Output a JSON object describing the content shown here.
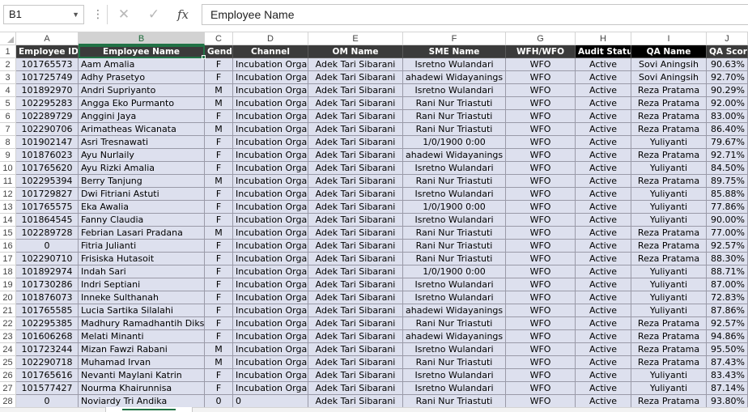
{
  "formula_bar": {
    "name_box": "B1",
    "name_box_dropdown_icon": "chevron-down-icon",
    "more_icon": "vertical-ellipsis-icon",
    "cancel_icon": "close-icon",
    "enter_icon": "checkmark-icon",
    "fx_label": "fx",
    "formula": "Employee Name"
  },
  "column_letters": [
    "A",
    "B",
    "C",
    "D",
    "E",
    "F",
    "G",
    "H",
    "I",
    "J"
  ],
  "selected_column": "B",
  "colors": {
    "header_bg": "#3b3b3b",
    "header_black_bg": "#000000",
    "data_bg": "#dde0ee",
    "selection": "#217346"
  },
  "headers": [
    "Employee ID",
    "Employee Name",
    "Gender",
    "Channel",
    "OM Name",
    "SME Name",
    "WFH/WFO",
    "Audit Status",
    "QA Name",
    "QA Score"
  ],
  "rows": [
    {
      "n": "2",
      "cells": [
        "101765573",
        "Aam Amalia",
        "F",
        "Incubation Organic",
        "Adek Tari Sibarani",
        "Isretno Wulandari",
        "WFO",
        "Active",
        "Sovi Aningsih",
        "90.63%"
      ]
    },
    {
      "n": "3",
      "cells": [
        "101725749",
        "Adhy Prasetyo",
        "F",
        "Incubation Organic",
        "Adek Tari Sibarani",
        "ahadewi Widayanings",
        "WFO",
        "Active",
        "Sovi Aningsih",
        "92.70%"
      ]
    },
    {
      "n": "4",
      "cells": [
        "101892970",
        "Andri Supriyanto",
        "M",
        "Incubation Organic",
        "Adek Tari Sibarani",
        "Isretno Wulandari",
        "WFO",
        "Active",
        "Reza Pratama",
        "90.29%"
      ]
    },
    {
      "n": "5",
      "cells": [
        "102295283",
        "Angga Eko Purmanto",
        "M",
        "Incubation Organic",
        "Adek Tari Sibarani",
        "Rani Nur Triastuti",
        "WFO",
        "Active",
        "Reza Pratama",
        "92.00%"
      ]
    },
    {
      "n": "6",
      "cells": [
        "102289729",
        "Anggini Jaya",
        "F",
        "Incubation Organic",
        "Adek Tari Sibarani",
        "Rani Nur Triastuti",
        "WFO",
        "Active",
        "Reza Pratama",
        "83.00%"
      ]
    },
    {
      "n": "7",
      "cells": [
        "102290706",
        "Arimatheas Wicanata",
        "M",
        "Incubation Organic",
        "Adek Tari Sibarani",
        "Rani Nur Triastuti",
        "WFO",
        "Active",
        "Reza Pratama",
        "86.40%"
      ]
    },
    {
      "n": "8",
      "cells": [
        "101902147",
        "Asri Tresnawati",
        "F",
        "Incubation Organic",
        "Adek Tari Sibarani",
        "1/0/1900 0:00",
        "WFO",
        "Active",
        "Yuliyanti",
        "79.67%"
      ]
    },
    {
      "n": "9",
      "cells": [
        "101876023",
        "Ayu Nurlaily",
        "F",
        "Incubation Organic",
        "Adek Tari Sibarani",
        "ahadewi Widayanings",
        "WFO",
        "Active",
        "Reza Pratama",
        "92.71%"
      ]
    },
    {
      "n": "10",
      "cells": [
        "101765620",
        "Ayu Rizki Amalia",
        "F",
        "Incubation Organic",
        "Adek Tari Sibarani",
        "Isretno Wulandari",
        "WFO",
        "Active",
        "Yuliyanti",
        "84.50%"
      ]
    },
    {
      "n": "11",
      "cells": [
        "102295394",
        "Berry Tanjung",
        "M",
        "Incubation Organic",
        "Adek Tari Sibarani",
        "Rani Nur Triastuti",
        "WFO",
        "Active",
        "Reza Pratama",
        "89.75%"
      ]
    },
    {
      "n": "12",
      "cells": [
        "101729827",
        "Dwi Fitriani Astuti",
        "F",
        "Incubation Organic",
        "Adek Tari Sibarani",
        "Isretno Wulandari",
        "WFO",
        "Active",
        "Yuliyanti",
        "85.88%"
      ]
    },
    {
      "n": "13",
      "cells": [
        "101765575",
        "Eka Awalia",
        "F",
        "Incubation Organic",
        "Adek Tari Sibarani",
        "1/0/1900 0:00",
        "WFO",
        "Active",
        "Yuliyanti",
        "77.86%"
      ]
    },
    {
      "n": "14",
      "cells": [
        "101864545",
        "Fanny Claudia",
        "F",
        "Incubation Organic",
        "Adek Tari Sibarani",
        "Isretno Wulandari",
        "WFO",
        "Active",
        "Yuliyanti",
        "90.00%"
      ]
    },
    {
      "n": "15",
      "cells": [
        "102289728",
        "Febrian Lasari Pradana",
        "M",
        "Incubation Organic",
        "Adek Tari Sibarani",
        "Rani Nur Triastuti",
        "WFO",
        "Active",
        "Reza Pratama",
        "77.00%"
      ]
    },
    {
      "n": "16",
      "cells": [
        "0",
        "Fitria Julianti",
        "F",
        "Incubation Organic",
        "Adek Tari Sibarani",
        "Rani Nur Triastuti",
        "WFO",
        "Active",
        "Reza Pratama",
        "92.57%"
      ]
    },
    {
      "n": "17",
      "cells": [
        "102290710",
        "Frisiska Hutasoit",
        "F",
        "Incubation Organic",
        "Adek Tari Sibarani",
        "Rani Nur Triastuti",
        "WFO",
        "Active",
        "Reza Pratama",
        "88.30%"
      ]
    },
    {
      "n": "18",
      "cells": [
        "101892974",
        "Indah Sari",
        "F",
        "Incubation Organic",
        "Adek Tari Sibarani",
        "1/0/1900 0:00",
        "WFO",
        "Active",
        "Yuliyanti",
        "88.71%"
      ]
    },
    {
      "n": "19",
      "cells": [
        "101730286",
        "Indri Septiani",
        "F",
        "Incubation Organic",
        "Adek Tari Sibarani",
        "Isretno Wulandari",
        "WFO",
        "Active",
        "Yuliyanti",
        "87.00%"
      ]
    },
    {
      "n": "20",
      "cells": [
        "101876073",
        "Inneke Sulthanah",
        "F",
        "Incubation Organic",
        "Adek Tari Sibarani",
        "Isretno Wulandari",
        "WFO",
        "Active",
        "Yuliyanti",
        "72.83%"
      ]
    },
    {
      "n": "21",
      "cells": [
        "101765585",
        "Lucia Sartika Silalahi",
        "F",
        "Incubation Organic",
        "Adek Tari Sibarani",
        "ahadewi Widayanings",
        "WFO",
        "Active",
        "Yuliyanti",
        "87.86%"
      ]
    },
    {
      "n": "22",
      "cells": [
        "102295385",
        "Madhury Ramadhantih Diks",
        "F",
        "Incubation Organic",
        "Adek Tari Sibarani",
        "Rani Nur Triastuti",
        "WFO",
        "Active",
        "Reza Pratama",
        "92.57%"
      ]
    },
    {
      "n": "23",
      "cells": [
        "101606268",
        "Melati Minanti",
        "F",
        "Incubation Organic",
        "Adek Tari Sibarani",
        "ahadewi Widayanings",
        "WFO",
        "Active",
        "Reza Pratama",
        "94.86%"
      ]
    },
    {
      "n": "24",
      "cells": [
        "101723244",
        "Mizan Fawzi Rabani",
        "M",
        "Incubation Organic",
        "Adek Tari Sibarani",
        "Isretno Wulandari",
        "WFO",
        "Active",
        "Reza Pratama",
        "95.50%"
      ]
    },
    {
      "n": "25",
      "cells": [
        "102290718",
        "Muhamad Irvan",
        "M",
        "Incubation Organic",
        "Adek Tari Sibarani",
        "Rani Nur Triastuti",
        "WFO",
        "Active",
        "Reza Pratama",
        "87.43%"
      ]
    },
    {
      "n": "26",
      "cells": [
        "101765616",
        "Nevanti Maylani Katrin",
        "F",
        "Incubation Organic",
        "Adek Tari Sibarani",
        "Isretno Wulandari",
        "WFO",
        "Active",
        "Yuliyanti",
        "83.43%"
      ]
    },
    {
      "n": "27",
      "cells": [
        "101577427",
        "Nourma Khairunnisa",
        "F",
        "Incubation Organic",
        "Adek Tari Sibarani",
        "Isretno Wulandari",
        "WFO",
        "Active",
        "Yuliyanti",
        "87.14%"
      ]
    },
    {
      "n": "28",
      "cells": [
        "0",
        "Noviardy Tri Andika",
        "0",
        "0",
        "Adek Tari Sibarani",
        "Rani Nur Triastuti",
        "WFO",
        "Active",
        "Reza Pratama",
        "93.80%"
      ]
    }
  ]
}
